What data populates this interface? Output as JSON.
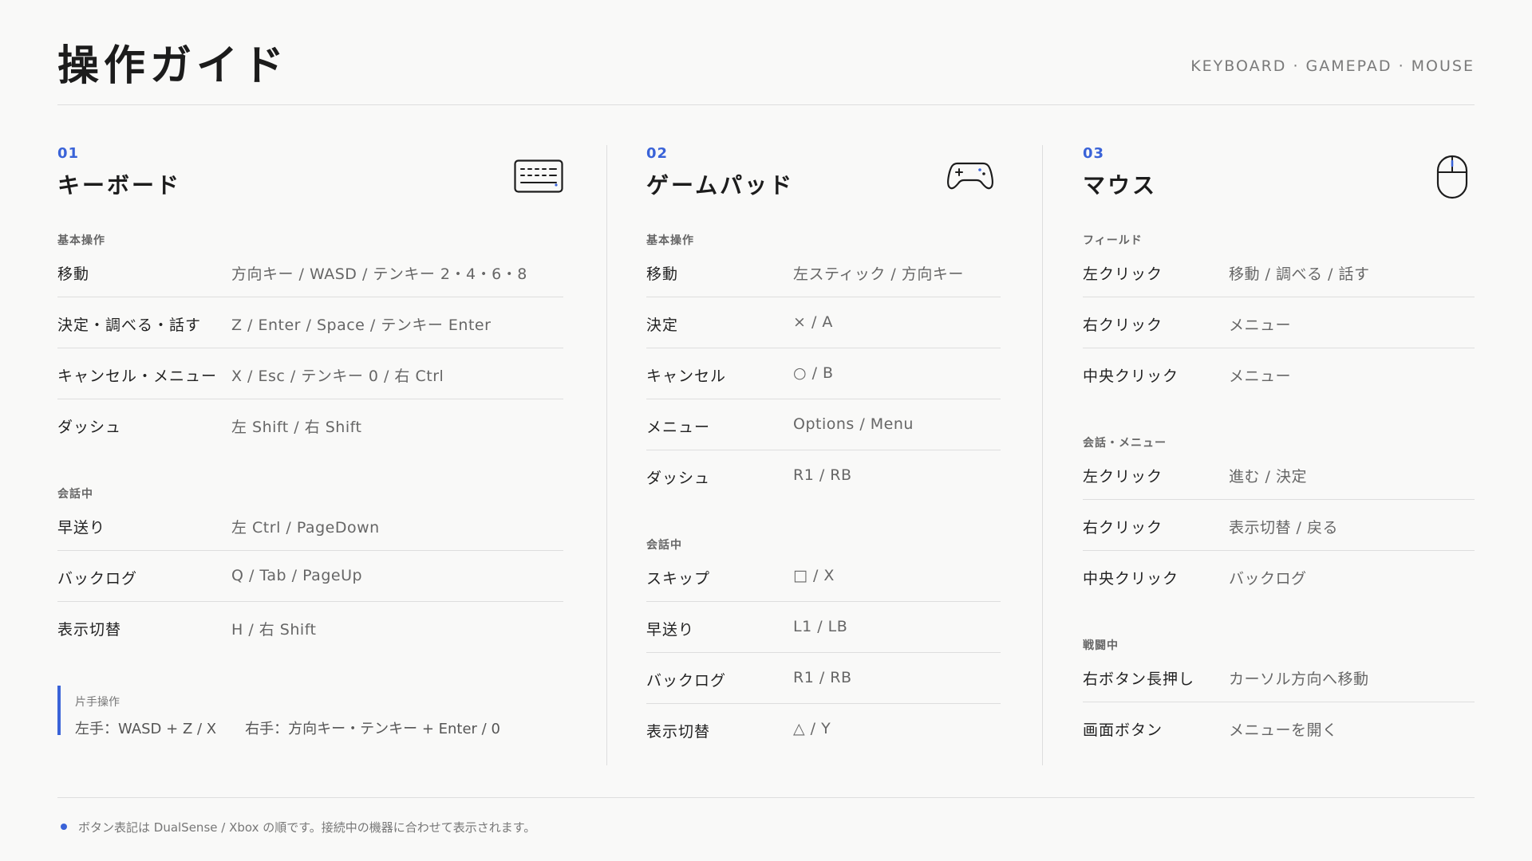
{
  "header": {
    "title": "操作ガイド",
    "subtitle": "KEYBOARD · GAMEPAD · MOUSE"
  },
  "accent_color": "#3a63d8",
  "sections": [
    {
      "num": "01",
      "title": "キーボード",
      "icon": "keyboard-icon",
      "groups": [
        {
          "label": "基本操作",
          "rows": [
            {
              "action": "移動",
              "key": "方向キー / WASD / テンキー 2・4・6・8"
            },
            {
              "action": "決定・調べる・話す",
              "key": "Z / Enter / Space / テンキー Enter"
            },
            {
              "action": "キャンセル・メニュー",
              "key": "X / Esc / テンキー 0 / 右 Ctrl"
            },
            {
              "action": "ダッシュ",
              "key": "左 Shift / 右 Shift"
            }
          ]
        },
        {
          "label": "会話中",
          "rows": [
            {
              "action": "早送り",
              "key": "左 Ctrl / PageDown"
            },
            {
              "action": "バックログ",
              "key": "Q / Tab / PageUp"
            },
            {
              "action": "表示切替",
              "key": "H / 右 Shift"
            }
          ]
        }
      ],
      "note": {
        "label": "片手操作",
        "left": "左手：WASD + Z / X",
        "right": "右手：方向キー・テンキー + Enter / 0"
      }
    },
    {
      "num": "02",
      "title": "ゲームパッド",
      "icon": "gamepad-icon",
      "groups": [
        {
          "label": "基本操作",
          "rows": [
            {
              "action": "移動",
              "key": "左スティック / 方向キー"
            },
            {
              "action": "決定",
              "key": "× / A"
            },
            {
              "action": "キャンセル",
              "key": "○ / B"
            },
            {
              "action": "メニュー",
              "key": "Options / Menu"
            },
            {
              "action": "ダッシュ",
              "key": "R1 / RB"
            }
          ]
        },
        {
          "label": "会話中",
          "rows": [
            {
              "action": "スキップ",
              "key": "□ / X"
            },
            {
              "action": "早送り",
              "key": "L1 / LB"
            },
            {
              "action": "バックログ",
              "key": "R1 / RB"
            },
            {
              "action": "表示切替",
              "key": "△ / Y"
            }
          ]
        }
      ]
    },
    {
      "num": "03",
      "title": "マウス",
      "icon": "mouse-icon",
      "groups": [
        {
          "label": "フィールド",
          "rows": [
            {
              "action": "左クリック",
              "key": "移動 / 調べる / 話す"
            },
            {
              "action": "右クリック",
              "key": "メニュー"
            },
            {
              "action": "中央クリック",
              "key": "メニュー"
            }
          ]
        },
        {
          "label": "会話・メニュー",
          "rows": [
            {
              "action": "左クリック",
              "key": "進む / 決定"
            },
            {
              "action": "右クリック",
              "key": "表示切替 / 戻る"
            },
            {
              "action": "中央クリック",
              "key": "バックログ"
            }
          ]
        },
        {
          "label": "戦闘中",
          "rows": [
            {
              "action": "右ボタン長押し",
              "key": "カーソル方向へ移動"
            },
            {
              "action": "画面ボタン",
              "key": "メニューを開く"
            }
          ]
        }
      ]
    }
  ],
  "footer": {
    "text": "ボタン表記は DualSense / Xbox の順です。接続中の機器に合わせて表示されます。"
  }
}
